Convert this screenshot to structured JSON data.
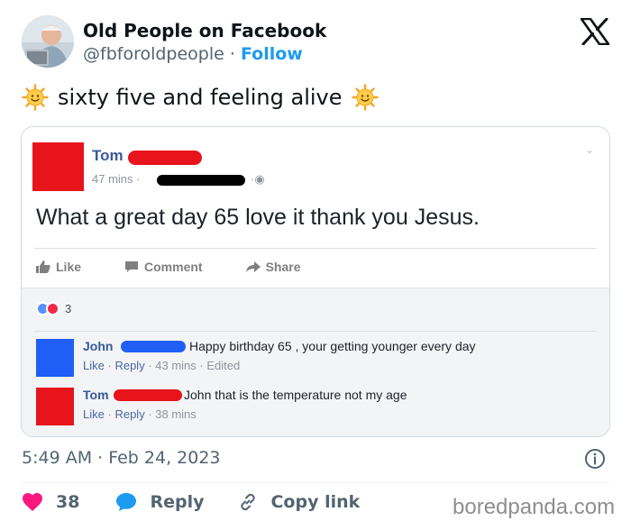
{
  "author": {
    "name": "Old People on Facebook",
    "handle": "@fbforoldpeople",
    "separator": "·",
    "follow_label": "Follow",
    "avatar_icon": "elderly-man-laptop-avatar"
  },
  "platform_icon": "x-logo-icon",
  "tweet": {
    "text": "sixty five and feeling alive",
    "emoji": "sun-emoji"
  },
  "fb_post": {
    "author": "Tom",
    "time": "47 mins ·",
    "body": "What a great day 65 love it thank you Jesus.",
    "actions": {
      "like": "Like",
      "comment": "Comment",
      "share": "Share"
    },
    "reaction_count": "3",
    "comments": [
      {
        "author": "John",
        "text": "Happy birthday 65 , your getting younger every day",
        "reply_like": "Like",
        "reply_reply": "Reply",
        "meta_tail": "· 43 mins · Edited",
        "avatar_color": "#1f5ff5"
      },
      {
        "author": "Tom",
        "text": "John that is the temperature not my age",
        "reply_like": "Like",
        "reply_reply": "Reply",
        "meta_tail": "· 38 mins",
        "avatar_color": "#e8141b"
      }
    ]
  },
  "footer": {
    "timestamp": "5:49 AM · Feb 24, 2023",
    "like_count": "38",
    "reply_label": "Reply",
    "copy_link_label": "Copy link",
    "watermark": "boredpanda.com"
  },
  "colors": {
    "accent": "#1d9bf0",
    "heart": "#f91880",
    "redaction": "#e8141b",
    "redaction_dark": "#000000"
  }
}
